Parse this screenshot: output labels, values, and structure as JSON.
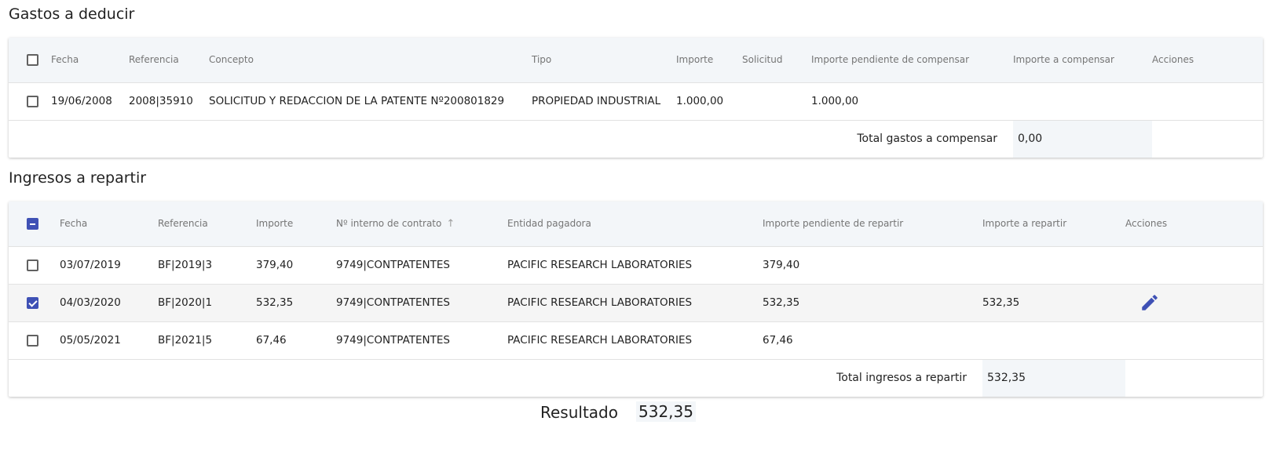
{
  "gastos": {
    "title": "Gastos a deducir",
    "columns": [
      "Fecha",
      "Referencia",
      "Concepto",
      "Tipo",
      "Importe",
      "Solicitud",
      "Importe pendiente de compensar",
      "Importe a compensar",
      "Acciones"
    ],
    "header_checkbox": "unchecked",
    "rows": [
      {
        "checked": false,
        "fecha": "19/06/2008",
        "referencia": "2008|35910",
        "concepto": "SOLICITUD Y REDACCION DE LA PATENTE Nº200801829",
        "tipo": "PROPIEDAD INDUSTRIAL",
        "importe": "1.000,00",
        "solicitud": "",
        "pendiente": "1.000,00",
        "a_compensar": ""
      }
    ],
    "total_label": "Total gastos a compensar",
    "total_value": "0,00"
  },
  "ingresos": {
    "title": "Ingresos a repartir",
    "columns": [
      "Fecha",
      "Referencia",
      "Importe",
      "Nº interno de contrato",
      "Entidad pagadora",
      "Importe pendiente de repartir",
      "Importe a repartir",
      "Acciones"
    ],
    "sort_icon": "arrow-up-icon",
    "header_checkbox": "indeterminate",
    "rows": [
      {
        "checked": false,
        "fecha": "03/07/2019",
        "referencia": "BF|2019|3",
        "importe": "379,40",
        "contrato": "9749|CONTPATENTES",
        "entidad": "PACIFIC RESEARCH LABORATORIES",
        "pendiente": "379,40",
        "a_repartir": ""
      },
      {
        "checked": true,
        "fecha": "04/03/2020",
        "referencia": "BF|2020|1",
        "importe": "532,35",
        "contrato": "9749|CONTPATENTES",
        "entidad": "PACIFIC RESEARCH LABORATORIES",
        "pendiente": "532,35",
        "a_repartir": "532,35",
        "action_icon": "edit-icon"
      },
      {
        "checked": false,
        "fecha": "05/05/2021",
        "referencia": "BF|2021|5",
        "importe": "67,46",
        "contrato": "9749|CONTPATENTES",
        "entidad": "PACIFIC RESEARCH LABORATORIES",
        "pendiente": "67,46",
        "a_repartir": ""
      }
    ],
    "total_label": "Total ingresos a repartir",
    "total_value": "532,35"
  },
  "resultado": {
    "label": "Resultado",
    "value": "532,35"
  },
  "colors": {
    "accent": "#3f51b5",
    "header_bg": "#f3f6f9"
  }
}
